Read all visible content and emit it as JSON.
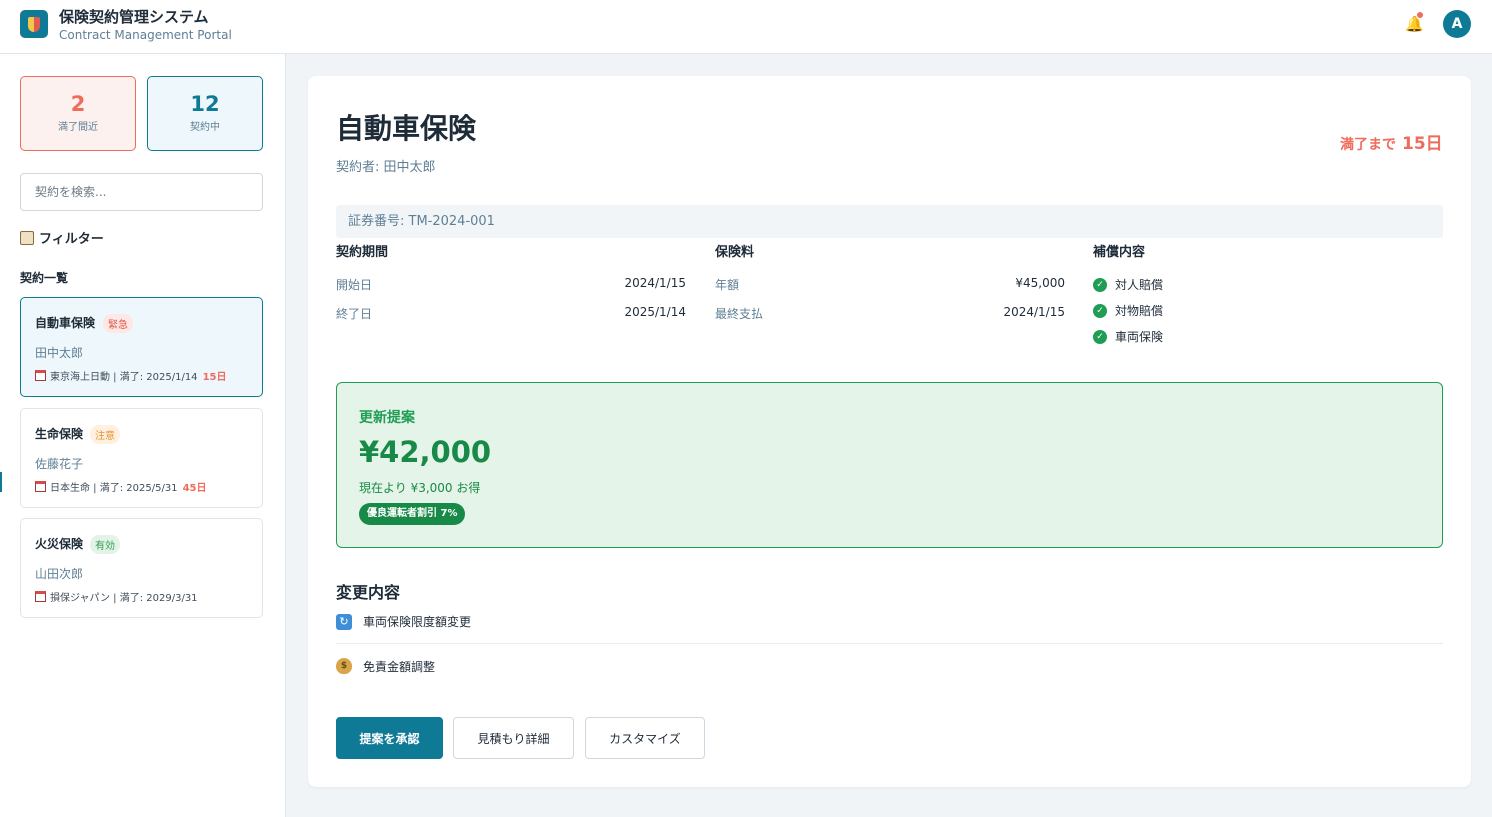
{
  "header": {
    "title": "保険契約管理システム",
    "subtitle": "Contract Management Portal",
    "avatar_initial": "A",
    "bell_icon": "bell-icon"
  },
  "sidebar": {
    "stats": [
      {
        "value": "2",
        "label": "満了間近",
        "color": "#ef6b5b"
      },
      {
        "value": "12",
        "label": "契約中",
        "color": "#0f7a96"
      }
    ],
    "search_placeholder": "契約を検索...",
    "filter_label": "フィルター",
    "list_heading": "契約一覧",
    "contracts": [
      {
        "name": "自動車保険",
        "badge": "緊急",
        "holder": "田中太郎",
        "meta": "東京海上日動 | 満了: 2025/1/14",
        "days": "15日"
      },
      {
        "name": "生命保険",
        "badge": "注意",
        "holder": "佐藤花子",
        "meta": "日本生命 | 満了: 2025/5/31",
        "days": "45日"
      },
      {
        "name": "火災保険",
        "badge": "有効",
        "holder": "山田次郎",
        "meta": "損保ジャパン | 満了: 2029/3/31",
        "days": ""
      }
    ]
  },
  "detail": {
    "title": "自動車保険",
    "holder": "契約者: 田中太郎",
    "expiry_label": "満了まで",
    "expiry_days": "15日",
    "policy_number": "証券番号: TM-2024-001",
    "period": {
      "heading": "契約期間",
      "rows": [
        {
          "label": "開始日",
          "value": "2024/1/15"
        },
        {
          "label": "終了日",
          "value": "2025/1/14"
        }
      ]
    },
    "premium": {
      "heading": "保険料",
      "rows": [
        {
          "label": "年額",
          "value": "¥45,000"
        },
        {
          "label": "最終支払",
          "value": "2024/1/15"
        }
      ]
    },
    "coverage": {
      "heading": "補償内容",
      "items": [
        "対人賠償",
        "対物賠償",
        "車両保険"
      ]
    },
    "renewal": {
      "title": "更新提案",
      "price": "¥42,000",
      "savings": "現在より ¥3,000 お得",
      "discount": "優良運転者割引 7%"
    },
    "changes": {
      "title": "変更内容",
      "items": [
        {
          "icon": "refresh-icon",
          "text": "車両保険限度額変更"
        },
        {
          "icon": "money-bag-icon",
          "text": "免責金額調整"
        }
      ]
    },
    "actions": {
      "approve": "提案を承認",
      "quote": "見積もり詳細",
      "customize": "カスタマイズ"
    }
  },
  "colors": {
    "accent": "#0f7a96",
    "urgent": "#ef6b5b",
    "success": "#1f9d55"
  }
}
